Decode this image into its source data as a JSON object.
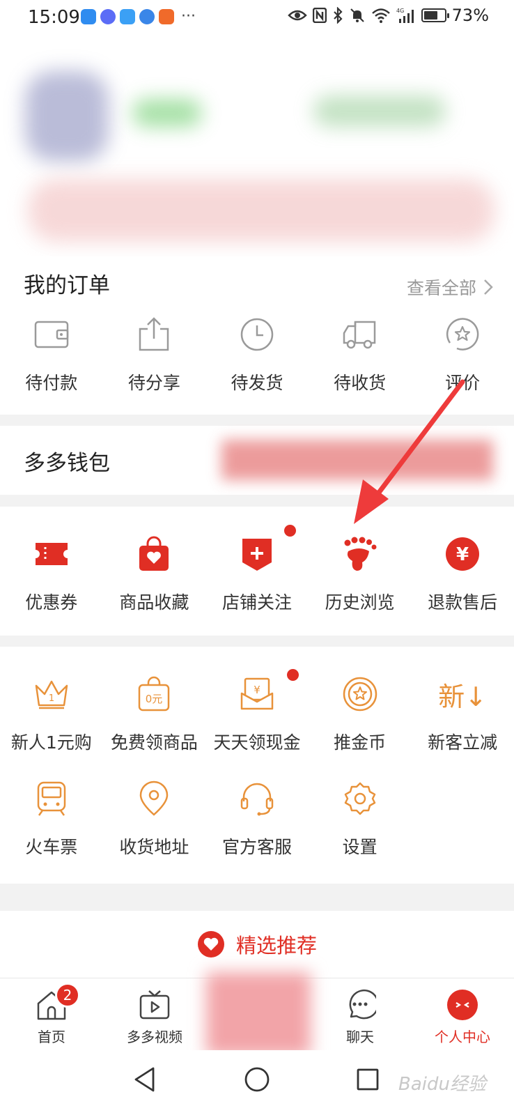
{
  "status_bar": {
    "time": "15:09",
    "battery": "73%",
    "battery_level": 0.73,
    "app_icons": [
      "weather-icon",
      "music-icon",
      "cloud-icon",
      "browser-icon",
      "game-icon"
    ],
    "more": "···"
  },
  "orders": {
    "title": "我的订单",
    "view_all": "查看全部",
    "items": [
      {
        "label": "待付款",
        "icon": "wallet-icon"
      },
      {
        "label": "待分享",
        "icon": "share-icon"
      },
      {
        "label": "待发货",
        "icon": "clock-icon"
      },
      {
        "label": "待收货",
        "icon": "truck-icon"
      },
      {
        "label": "评价",
        "icon": "star-review-icon"
      }
    ]
  },
  "wallet": {
    "title": "多多钱包"
  },
  "services": {
    "items": [
      {
        "label": "优惠券",
        "icon": "coupon-icon"
      },
      {
        "label": "商品收藏",
        "icon": "bag-heart-icon"
      },
      {
        "label": "店铺关注",
        "icon": "store-plus-icon"
      },
      {
        "label": "历史浏览",
        "icon": "footprint-icon"
      },
      {
        "label": "退款售后",
        "icon": "yen-icon"
      }
    ]
  },
  "tools": {
    "row1": [
      {
        "label": "新人1元购",
        "icon": "crown-icon"
      },
      {
        "label": "免费领商品",
        "icon": "free-bag-icon"
      },
      {
        "label": "天天领现金",
        "icon": "cash-envelope-icon"
      },
      {
        "label": "推金币",
        "icon": "coin-icon"
      },
      {
        "label": "新客立减",
        "icon": "new-discount-icon",
        "glyph": "新↓"
      }
    ],
    "row2": [
      {
        "label": "火车票",
        "icon": "train-icon"
      },
      {
        "label": "收货地址",
        "icon": "location-icon"
      },
      {
        "label": "官方客服",
        "icon": "headset-icon"
      },
      {
        "label": "设置",
        "icon": "settings-icon"
      }
    ]
  },
  "recommend": {
    "label": "精选推荐"
  },
  "tab_bar": {
    "tabs": [
      {
        "label": "首页",
        "icon": "home-icon",
        "badge": "2"
      },
      {
        "label": "多多视频",
        "icon": "video-icon"
      },
      {
        "label": "聊天",
        "icon": "chat-icon"
      },
      {
        "label": "个人中心",
        "icon": "profile-icon",
        "active": true
      }
    ]
  },
  "watermark": "Baidu经验",
  "colors": {
    "accent": "#e02e24",
    "orange": "#e8923a",
    "gray_icon": "#9a9a9a"
  }
}
